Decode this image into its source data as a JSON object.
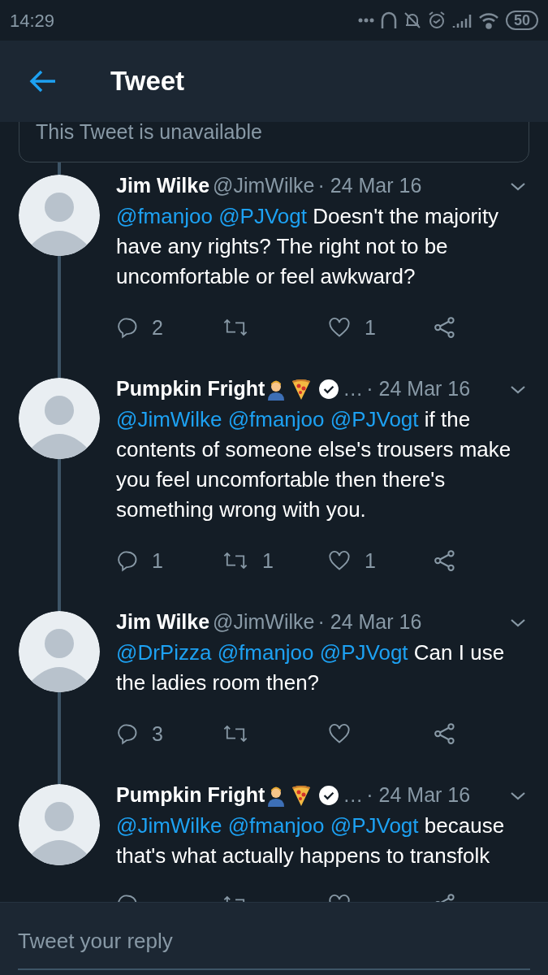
{
  "status_bar": {
    "time": "14:29",
    "battery": "50"
  },
  "header": {
    "title": "Tweet"
  },
  "unavailable_notice": "This Tweet is unavailable",
  "tweets": [
    {
      "name": "Jim Wilke",
      "verified": false,
      "handle": "@JimWilke",
      "date": "· 24 Mar 16",
      "mentions": [
        "@fmanjoo",
        "@PJVogt"
      ],
      "text": "Doesn't the majority have any rights? The right not to be uncomfortable or feel awkward?",
      "replies": "2",
      "likes": "1"
    },
    {
      "name": "Pumpkin Fright",
      "badges": [
        {
          "kind": "doctor"
        },
        {
          "kind": "pizza"
        }
      ],
      "verified": true,
      "handle": "…",
      "date": "· 24 Mar 16",
      "mentions": [
        "@JimWilke",
        "@fmanjoo",
        "@PJVogt"
      ],
      "text": "if the contents of someone else's trousers make you feel uncomfortable then there's something wrong with you.",
      "replies": "1",
      "retweets": "1",
      "likes": "1"
    },
    {
      "name": "Jim Wilke",
      "verified": false,
      "handle": "@JimWilke",
      "date": "· 24 Mar 16",
      "mentions": [
        "@DrPizza",
        "@fmanjoo",
        "@PJVogt"
      ],
      "text": "Can I use the ladies room then?",
      "replies": "3"
    },
    {
      "name": "Pumpkin Fright",
      "badges": [
        {
          "kind": "doctor"
        },
        {
          "kind": "pizza"
        }
      ],
      "verified": true,
      "handle": "…",
      "date": "· 24 Mar 16",
      "mentions": [
        "@JimWilke",
        "@fmanjoo",
        "@PJVogt"
      ],
      "text": "because that's what actually happens to transfolk"
    }
  ],
  "reply_field": {
    "placeholder": "Tweet your reply"
  }
}
